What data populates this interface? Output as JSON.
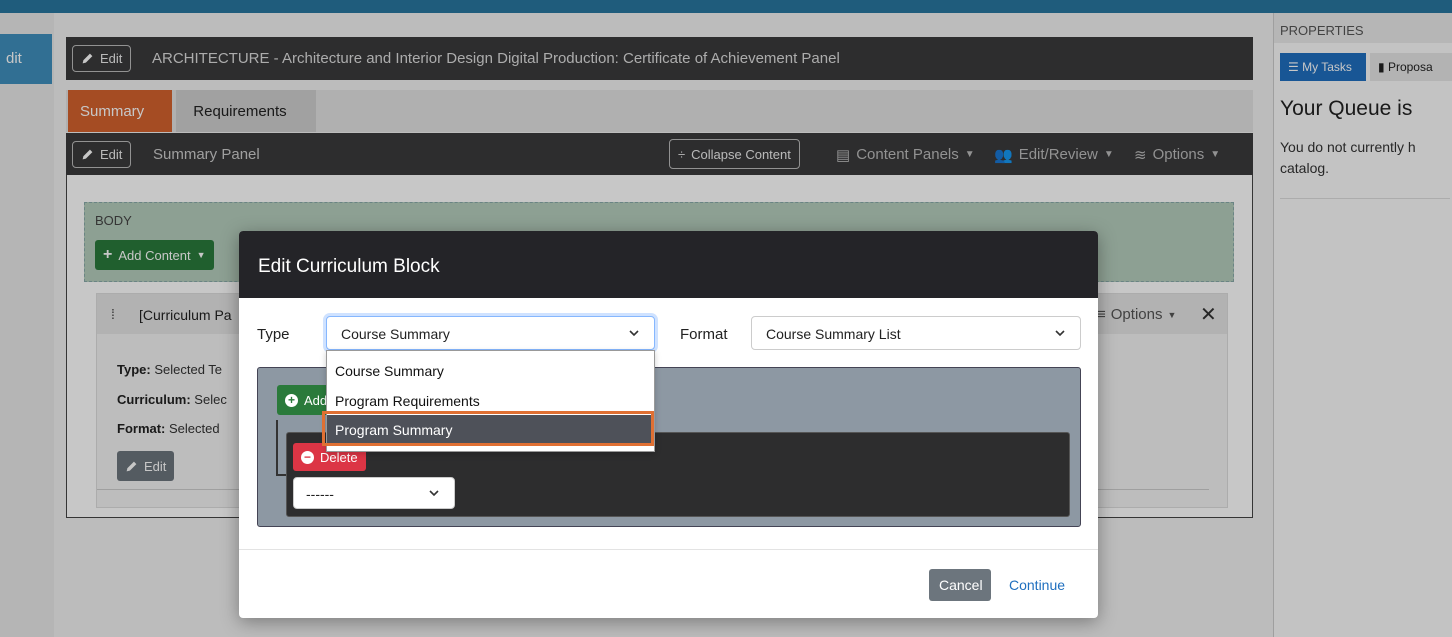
{
  "left_strip": {
    "edit_label": "dit"
  },
  "title_bar": {
    "edit_label": "Edit",
    "title": "ARCHITECTURE - Architecture and Interior Design Digital Production: Certificate of Achievement Panel"
  },
  "tabs": [
    {
      "label": "Summary",
      "active": true
    },
    {
      "label": "Requirements",
      "active": false
    }
  ],
  "panel_bar": {
    "edit_label": "Edit",
    "title": "Summary Panel",
    "collapse_label": "Collapse Content",
    "content_panels_label": "Content Panels",
    "edit_review_label": "Edit/Review",
    "options_label": "Options"
  },
  "body_region": {
    "label": "BODY",
    "add_content_label": "Add Content"
  },
  "curriculum_card": {
    "title": "[Curriculum Pa",
    "options_label": "Options",
    "type_label": "Type:",
    "type_value": "Selected Te",
    "curriculum_label": "Curriculum:",
    "curriculum_value": "Selec",
    "format_label": "Format:",
    "format_value": "Selected",
    "edit_label": "Edit"
  },
  "properties": {
    "header": "PROPERTIES",
    "tab_my_tasks": "My Tasks",
    "tab_proposals": "Proposa",
    "queue_title": "Your Queue is",
    "queue_text": "You do not currently h catalog."
  },
  "modal": {
    "title": "Edit Curriculum Block",
    "type_label": "Type",
    "type_value": "Course Summary",
    "format_label": "Format",
    "format_value": "Course Summary List",
    "type_options": [
      "Course Summary",
      "Program Requirements",
      "Program Summary"
    ],
    "highlighted_option": "Program Summary",
    "add_label": "Add",
    "delete_label": "Delete",
    "inner_select_value": "------",
    "cancel_label": "Cancel",
    "continue_label": "Continue"
  },
  "colors": {
    "top_bar": "#1f5c7c",
    "tab_active": "#d4622e",
    "dark_bar": "#3a3a3c",
    "green_button": "#2a7a3b",
    "red_button": "#dc3545",
    "highlight_outline": "#e07033",
    "link": "#1f6fbf"
  }
}
